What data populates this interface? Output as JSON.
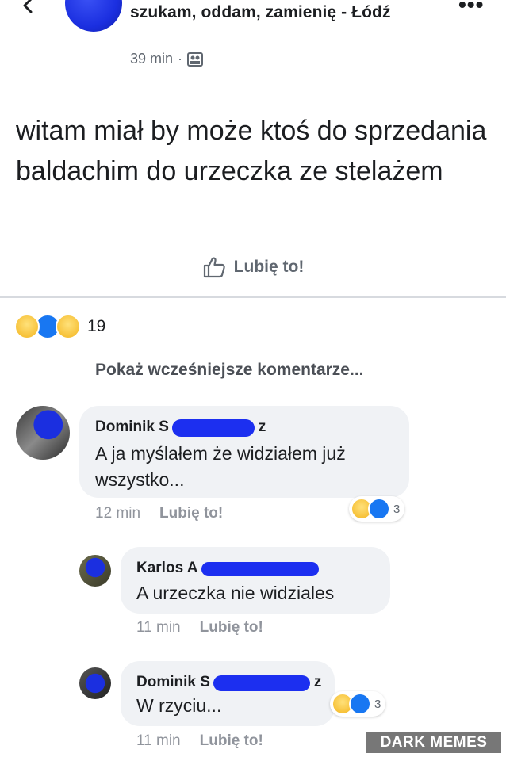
{
  "header": {
    "group_name": "szukam, oddam, zamienię - Łódź",
    "time": "39 min",
    "separator": "·"
  },
  "post": {
    "text": "witam miał by może ktoś do sprzedania baldachim do urzeczka ze stelażem",
    "like_label": "Lubię to!"
  },
  "reactions": {
    "icons": [
      "haha-emoji",
      "like-emoji",
      "wow-emoji"
    ],
    "count": "19"
  },
  "show_earlier_label": "Pokaż wcześniejsze komentarze...",
  "comments": [
    {
      "name_first": "Dominik S",
      "name_last_suffix": "z",
      "text": "A ja myślałem że widziałem już wszystko...",
      "time": "12 min",
      "like_label": "Lubię to!",
      "reactions": [
        "haha-emoji",
        "like-emoji"
      ],
      "reaction_count": "3"
    },
    {
      "name_first": "Karlos A",
      "text": "A urzeczka nie widziales",
      "time": "11 min",
      "like_label": "Lubię to!"
    },
    {
      "name_first": "Dominik S",
      "name_last_suffix": "z",
      "text": "W rzyciu...",
      "time": "11 min",
      "like_label": "Lubię to!",
      "reactions": [
        "haha-emoji",
        "like-emoji"
      ],
      "reaction_count": "3"
    }
  ],
  "watermark": "DARK MEMES",
  "colors": {
    "redaction": "#1c2ff0",
    "like_blue": "#1877f2",
    "emoji_yellow": "#f7c23a",
    "bubble": "#f0f2f5",
    "meta_gray": "#90949c"
  }
}
